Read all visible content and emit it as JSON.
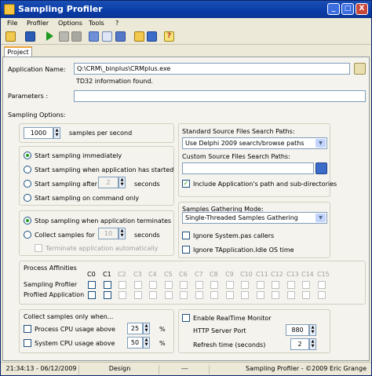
{
  "window": {
    "title": "Sampling Profiler",
    "minimize": "_",
    "maximize": "□",
    "close": "X"
  },
  "menu": [
    "File",
    "Profiler",
    "Options",
    "Tools",
    "?"
  ],
  "tab": "Project",
  "app_name": {
    "label": "Application Name:",
    "value": "Q:\\CRM\\_binplus\\CRMplus.exe",
    "info": "TD32 information found."
  },
  "parameters": {
    "label": "Parameters :",
    "value": ""
  },
  "sampling_options": "Sampling Options:",
  "samples": {
    "value": "1000",
    "label": "samples per second"
  },
  "start": {
    "immediately": "Start sampling immediately",
    "when_started": "Start sampling when application has started",
    "after": "Start sampling after",
    "after_value": "2",
    "seconds": "seconds",
    "on_command": "Start sampling on command only"
  },
  "stop": {
    "terminates": "Stop sampling when application terminates",
    "collect_for": "Collect samples for",
    "collect_value": "10",
    "seconds": "seconds",
    "terminate_auto": "Terminate application automatically"
  },
  "affinities": {
    "title": "Process Affinities",
    "cores": [
      "C0",
      "C1",
      "C2",
      "C3",
      "C4",
      "C5",
      "C6",
      "C7",
      "C8",
      "C9",
      "C10",
      "C11",
      "C12",
      "C13",
      "C14",
      "C15"
    ],
    "row1": "Sampling Profiler",
    "row2": "Profiled Application"
  },
  "collect_when": {
    "title": "Collect samples only when...",
    "process_cpu": "Process CPU usage above",
    "process_value": "25",
    "system_cpu": "System CPU usage above",
    "system_value": "50",
    "pct": "%"
  },
  "source_paths": {
    "standard_label": "Standard Source Files Search Paths:",
    "standard_value": "Use Delphi 2009 search/browse paths",
    "custom_label": "Custom Source Files Search Paths:",
    "custom_value": "",
    "include": "Include Application's path and sub-directories"
  },
  "gathering": {
    "label": "Samples Gathering Mode:",
    "value": "Single-Threaded Samples Gathering",
    "ignore_system": "Ignore System.pas callers",
    "ignore_idle": "Ignore TApplication.Idle OS time"
  },
  "realtime": {
    "enable": "Enable RealTime Monitor",
    "port_label": "HTTP Server Port",
    "port_value": "880",
    "refresh_label": "Refresh time (seconds)",
    "refresh_value": "2"
  },
  "status": [
    "21:34:13 - 06/12/2009",
    "Design",
    "---",
    "Sampling Profiler - ©2009 Eric Grange"
  ]
}
